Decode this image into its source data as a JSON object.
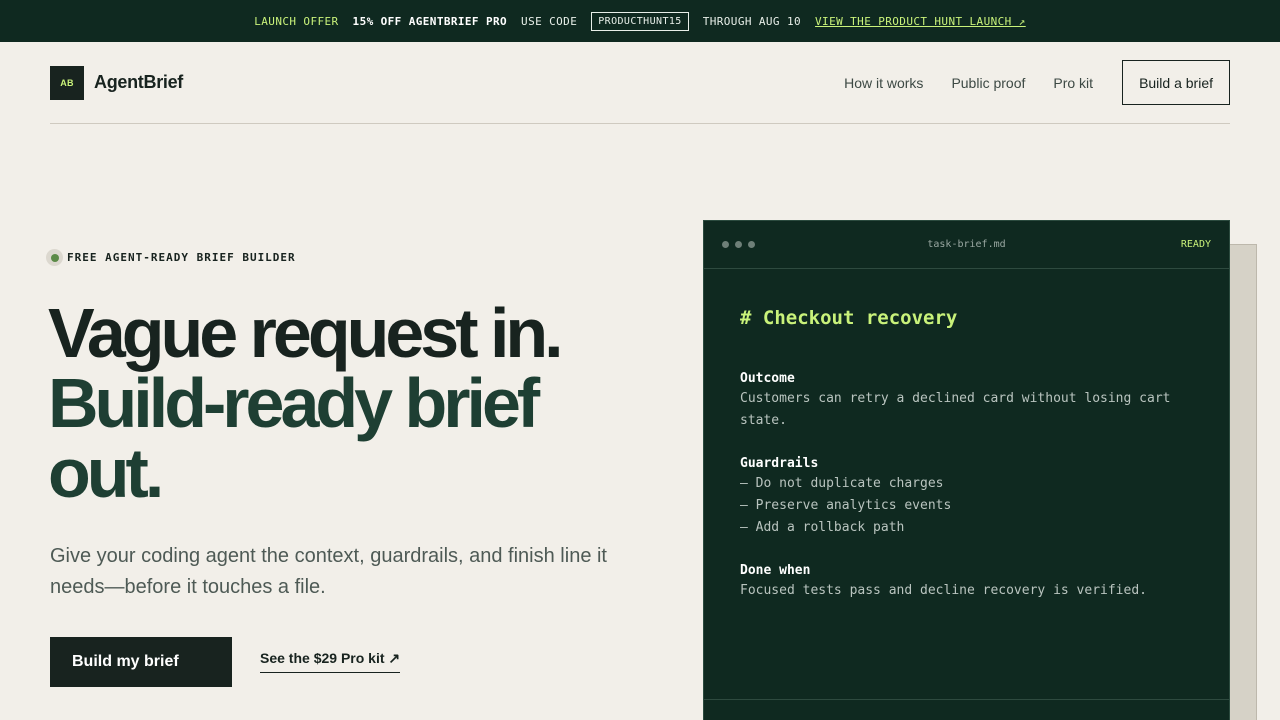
{
  "promo": {
    "offer_label": "LAUNCH OFFER",
    "discount": "15% OFF AGENTBRIEF PRO",
    "use_code": "USE CODE",
    "code": "PRODUCTHUNT15",
    "through": "THROUGH AUG 10",
    "link": "VIEW THE PRODUCT HUNT LAUNCH ↗"
  },
  "header": {
    "logo_mark": "AB",
    "logo_text": "AgentBrief",
    "nav": [
      "How it works",
      "Public proof",
      "Pro kit"
    ],
    "cta": "Build a brief"
  },
  "hero": {
    "badge": "FREE AGENT-READY BRIEF BUILDER",
    "headline_line1": "Vague request in.",
    "headline_line2": "Build-ready brief",
    "headline_line3": "out.",
    "subtitle": "Give your coding agent the context, guardrails, and finish line it needs—before it touches a file.",
    "primary_button": "Build my brief",
    "secondary_link": "See the $29 Pro kit ↗"
  },
  "brief_card": {
    "filename": "task-brief.md",
    "status": "READY",
    "title": "# Checkout recovery",
    "sections": [
      {
        "heading": "Outcome",
        "lines": [
          "Customers can retry a declined card without losing cart state."
        ]
      },
      {
        "heading": "Guardrails",
        "lines": [
          "— Do not duplicate charges",
          "— Preserve analytics events",
          "— Add a rollback path"
        ]
      },
      {
        "heading": "Done when",
        "lines": [
          "Focused tests pass and decline recovery is verified."
        ]
      }
    ]
  },
  "colors": {
    "dark_green": "#0f2920",
    "accent_lime": "#c9f27a",
    "ink": "#18231f",
    "background": "#f2efe9"
  }
}
